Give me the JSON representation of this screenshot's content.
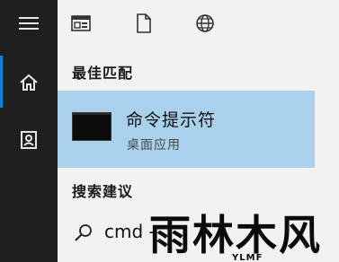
{
  "rail": {
    "items": [
      {
        "icon": "hamburger-menu-icon"
      },
      {
        "icon": "home-icon"
      },
      {
        "icon": "user-contact-icon"
      }
    ]
  },
  "toolbar": {
    "items": [
      {
        "icon": "app-window-icon"
      },
      {
        "icon": "document-icon"
      },
      {
        "icon": "globe-icon"
      }
    ]
  },
  "best_match": {
    "section_label": "最佳匹配",
    "title": "命令提示符",
    "subtitle": "桌面应用"
  },
  "suggestions": {
    "section_label": "搜索建议",
    "items": [
      {
        "icon": "search-icon",
        "text": "cmd -"
      }
    ]
  },
  "watermark": {
    "main": "雨林木风",
    "sub": "YLMF"
  },
  "colors": {
    "rail": "#1f1f1f",
    "panel": "#f2f2f2",
    "highlight": "#a9d1eb",
    "accent": "#0a84d6"
  }
}
